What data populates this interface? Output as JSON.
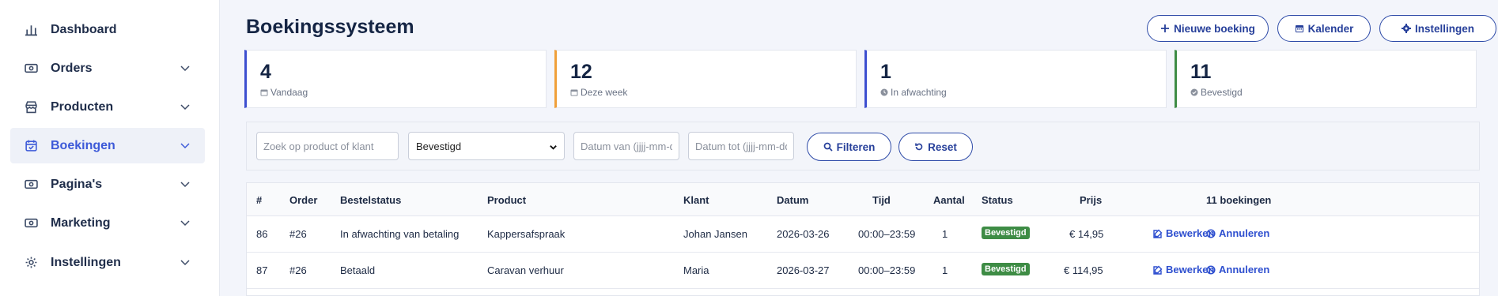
{
  "sidebar": {
    "items": [
      {
        "label": "Dashboard",
        "icon": "bar-chart-icon",
        "has_children": false
      },
      {
        "label": "Orders",
        "icon": "money-icon",
        "has_children": true
      },
      {
        "label": "Producten",
        "icon": "store-icon",
        "has_children": true
      },
      {
        "label": "Boekingen",
        "icon": "calendar-check-icon",
        "has_children": true,
        "active": true
      },
      {
        "label": "Pagina's",
        "icon": "money-icon",
        "has_children": true
      },
      {
        "label": "Marketing",
        "icon": "money-icon",
        "has_children": true
      },
      {
        "label": "Instellingen",
        "icon": "gear-icon",
        "has_children": true
      }
    ]
  },
  "header": {
    "title": "Boekingssysteem",
    "buttons": {
      "new_booking": "Nieuwe boeking",
      "calendar": "Kalender",
      "settings": "Instellingen"
    }
  },
  "stats": [
    {
      "value": "4",
      "label": "Vandaag",
      "color": "#3d4fd0",
      "icon": "calendar-icon"
    },
    {
      "value": "12",
      "label": "Deze week",
      "color": "#f0a03a",
      "icon": "calendar-icon"
    },
    {
      "value": "1",
      "label": "In afwachting",
      "color": "#3d4fd0",
      "icon": "clock-icon"
    },
    {
      "value": "11",
      "label": "Bevestigd",
      "color": "#3e8c45",
      "icon": "check-circle-icon"
    }
  ],
  "filters": {
    "search_placeholder": "Zoek op product of klant",
    "status_selected": "Bevestigd",
    "date_from_placeholder": "Datum van (jjjj-mm-dd)",
    "date_to_placeholder": "Datum tot (jjjj-mm-dd)",
    "filter_label": "Filteren",
    "reset_label": "Reset"
  },
  "table": {
    "headers": {
      "id": "#",
      "order": "Order",
      "order_status": "Bestelstatus",
      "product": "Product",
      "customer": "Klant",
      "date": "Datum",
      "time": "Tijd",
      "quantity": "Aantal",
      "status": "Status",
      "price": "Prijs",
      "count": "11 boekingen"
    },
    "rows": [
      {
        "id": "86",
        "order": "#26",
        "order_status": "In afwachting van betaling",
        "product": "Kappersafspraak",
        "customer": "Johan Jansen",
        "date": "2026-03-26",
        "time": "00:00–23:59",
        "quantity": "1",
        "status": "Bevestigd",
        "price": "€ 14,95",
        "edit": "Bewerken",
        "cancel": "Annuleren"
      },
      {
        "id": "87",
        "order": "#26",
        "order_status": "Betaald",
        "product": "Caravan verhuur",
        "customer": "Maria",
        "date": "2026-03-27",
        "time": "00:00–23:59",
        "quantity": "1",
        "status": "Bevestigd",
        "price": "€ 114,95",
        "edit": "Bewerken",
        "cancel": "Annuleren"
      }
    ],
    "status_color": "#3e8c45"
  }
}
